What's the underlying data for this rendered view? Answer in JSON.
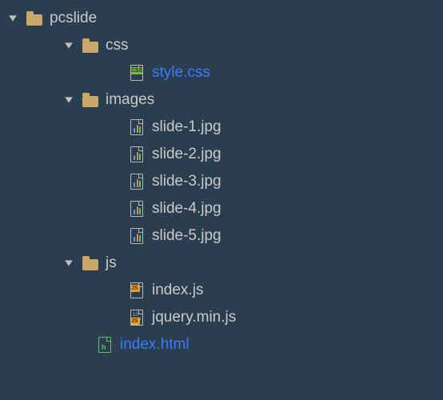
{
  "tree": {
    "root": {
      "name": "pcslide",
      "children": {
        "css": {
          "name": "css",
          "files": {
            "style": "style.css"
          }
        },
        "images": {
          "name": "images",
          "files": {
            "s1": "slide-1.jpg",
            "s2": "slide-2.jpg",
            "s3": "slide-3.jpg",
            "s4": "slide-4.jpg",
            "s5": "slide-5.jpg"
          }
        },
        "js": {
          "name": "js",
          "files": {
            "index": "index.js",
            "jquery": "jquery.min.js"
          }
        },
        "files": {
          "index": "index.html"
        }
      }
    }
  }
}
